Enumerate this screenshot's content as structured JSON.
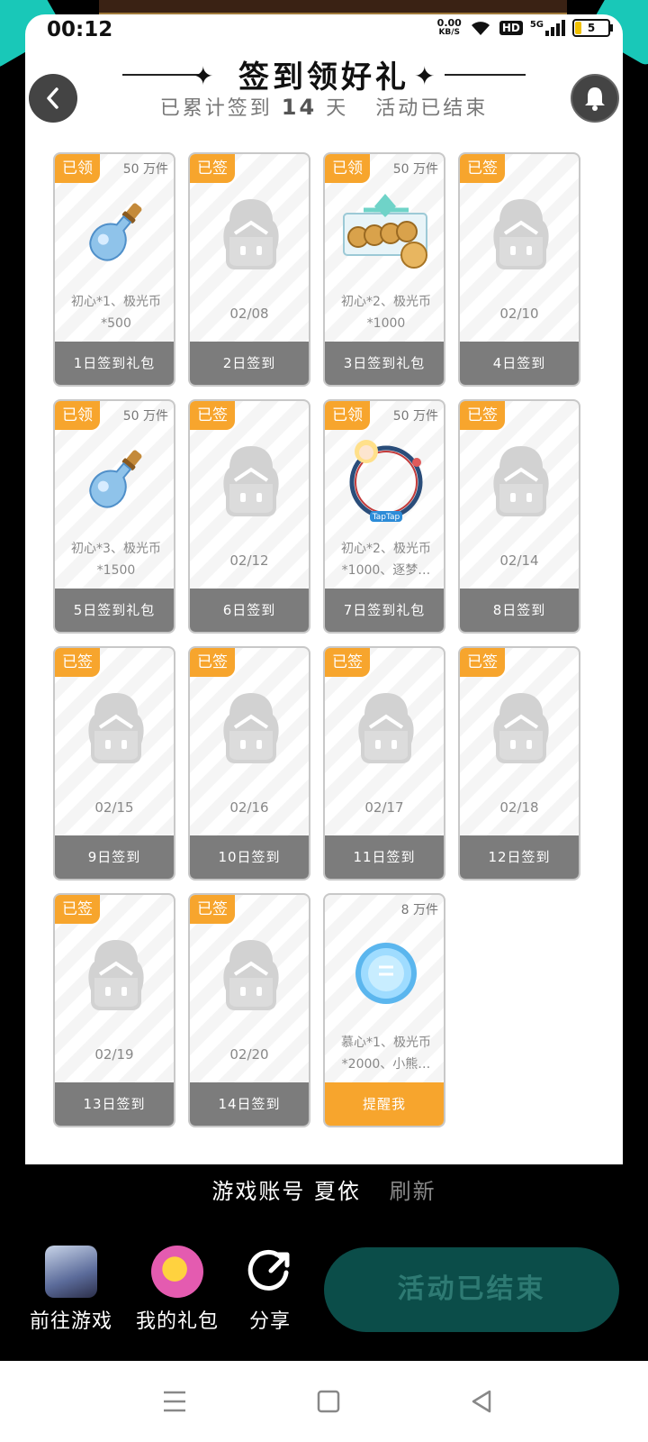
{
  "status": {
    "time": "00:12",
    "netspeed_top": "0.00",
    "netspeed_unit": "KB/S",
    "hd": "HD",
    "net": "5G",
    "battery": "5"
  },
  "header": {
    "title": "签到领好礼",
    "subtitle_prefix": "已累计签到",
    "days": "14",
    "subtitle_suffix": "天",
    "status": "活动已结束"
  },
  "cards": [
    {
      "tag": "已领",
      "stock": "50 万件",
      "desc": "初心*1、极光币*500",
      "footer": "1日签到礼包",
      "item_icon": "potion-icon"
    },
    {
      "tag": "已签",
      "date": "02/08",
      "footer": "2日签到",
      "item_icon": "placeholder-avatar-icon"
    },
    {
      "tag": "已领",
      "stock": "50 万件",
      "desc": "初心*2、极光币*1000",
      "footer": "3日签到礼包",
      "item_icon": "coin-box-icon"
    },
    {
      "tag": "已签",
      "date": "02/10",
      "footer": "4日签到",
      "item_icon": "placeholder-avatar-icon"
    },
    {
      "tag": "已领",
      "stock": "50 万件",
      "desc": "初心*3、极光币*1500",
      "footer": "5日签到礼包",
      "item_icon": "potion-icon"
    },
    {
      "tag": "已签",
      "date": "02/12",
      "footer": "6日签到",
      "item_icon": "placeholder-avatar-icon"
    },
    {
      "tag": "已领",
      "stock": "50 万件",
      "desc": "初心*2、极光币*1000、逐梦…",
      "footer": "7日签到礼包",
      "item_icon": "avatar-frame-icon",
      "frame_text": "TapTap"
    },
    {
      "tag": "已签",
      "date": "02/14",
      "footer": "8日签到",
      "item_icon": "placeholder-avatar-icon"
    },
    {
      "tag": "已签",
      "date": "02/15",
      "footer": "9日签到",
      "item_icon": "placeholder-avatar-icon"
    },
    {
      "tag": "已签",
      "date": "02/16",
      "footer": "10日签到",
      "item_icon": "placeholder-avatar-icon"
    },
    {
      "tag": "已签",
      "date": "02/17",
      "footer": "11日签到",
      "item_icon": "placeholder-avatar-icon"
    },
    {
      "tag": "已签",
      "date": "02/18",
      "footer": "12日签到",
      "item_icon": "placeholder-avatar-icon"
    },
    {
      "tag": "已签",
      "date": "02/19",
      "footer": "13日签到",
      "item_icon": "placeholder-avatar-icon"
    },
    {
      "tag": "已签",
      "date": "02/20",
      "footer": "14日签到",
      "item_icon": "placeholder-avatar-icon"
    },
    {
      "tag": "",
      "stock": "8 万件",
      "desc": "慕心*1、极光币*2000、小熊…",
      "footer": "提醒我",
      "item_icon": "blue-coin-icon"
    }
  ],
  "account": {
    "label": "游戏账号",
    "name": "夏依",
    "refresh": "刷新"
  },
  "bottom": {
    "go_game": "前往游戏",
    "my_gifts": "我的礼包",
    "share": "分享",
    "end_button": "活动已结束"
  },
  "colors": {
    "accent_orange": "#f7a52d",
    "card_footer": "#7c7c7c",
    "end_button_bg": "#0b4d49",
    "teal_deco": "#19c8b8"
  }
}
